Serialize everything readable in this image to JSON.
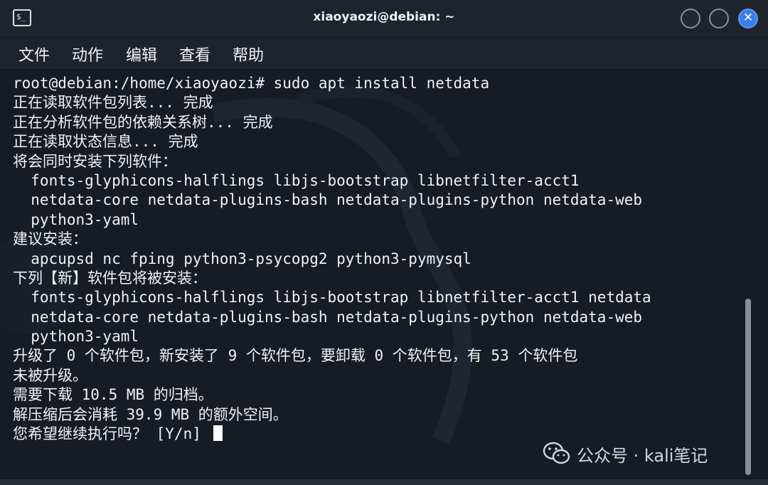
{
  "window": {
    "title": "xiaoyaozi@debian: ~",
    "close_glyph": "✕",
    "icon": "terminal-icon"
  },
  "menu": {
    "items": [
      "文件",
      "动作",
      "编辑",
      "查看",
      "帮助"
    ]
  },
  "terminal": {
    "lines": [
      "root@debian:/home/xiaoyaozi# sudo apt install netdata",
      "正在读取软件包列表... 完成",
      "正在分析软件包的依赖关系树... 完成",
      "正在读取状态信息... 完成",
      "将会同时安装下列软件：",
      "  fonts-glyphicons-halflings libjs-bootstrap libnetfilter-acct1",
      "  netdata-core netdata-plugins-bash netdata-plugins-python netdata-web",
      "  python3-yaml",
      "建议安装：",
      "  apcupsd nc fping python3-psycopg2 python3-pymysql",
      "下列【新】软件包将被安装：",
      "  fonts-glyphicons-halflings libjs-bootstrap libnetfilter-acct1 netdata",
      "  netdata-core netdata-plugins-bash netdata-plugins-python netdata-web",
      "  python3-yaml",
      "升级了 0 个软件包，新安装了 9 个软件包，要卸载 0 个软件包，有 53 个软件包",
      "未被升级。",
      "需要下载 10.5 MB 的归档。",
      "解压缩后会消耗 39.9 MB 的额外空间。",
      "您希望继续执行吗？ [Y/n] "
    ]
  },
  "watermark": {
    "text": "公众号 · kali笔记",
    "icon": "wechat-icon"
  }
}
